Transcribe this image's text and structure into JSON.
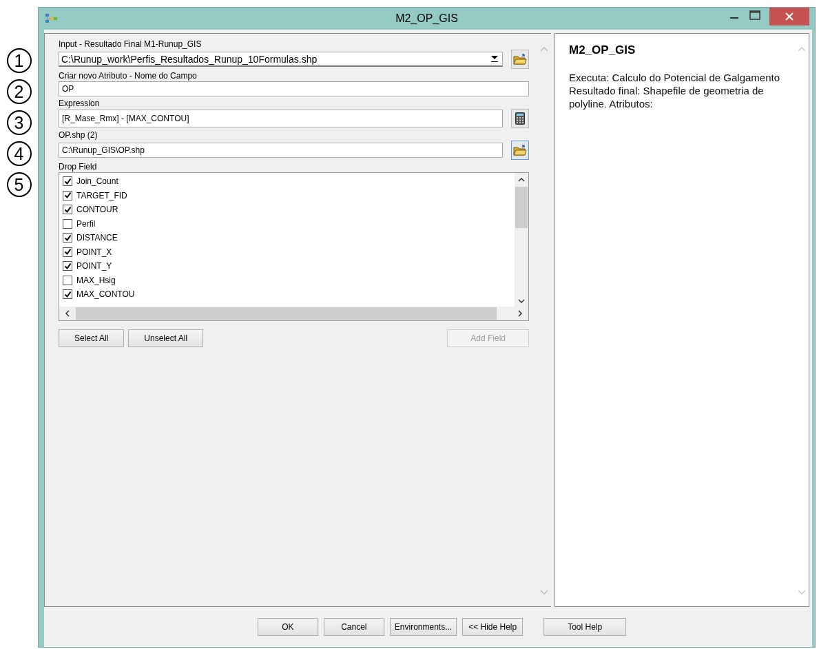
{
  "annotations": [
    "1",
    "2",
    "3",
    "4",
    "5"
  ],
  "window": {
    "title": "M2_OP_GIS"
  },
  "parameters": [
    {
      "kind": "combo",
      "label": "Input - Resultado Final M1-Runup_GIS",
      "value": "C:\\Runup_work\\Perfis_Resultados_Runup_10Formulas.shp",
      "button": {
        "kind": "browse"
      }
    },
    {
      "kind": "text",
      "label": "Criar novo Atributo - Nome do Campo",
      "value": "OP"
    },
    {
      "kind": "text",
      "label": "Expression",
      "value": "[R_Mase_Rmx] - [MAX_CONTOU]",
      "button": {
        "kind": "calculator"
      }
    },
    {
      "kind": "text",
      "label": "OP.shp (2)",
      "value": "C:\\Runup_GIS\\OP.shp",
      "button": {
        "kind": "browse"
      }
    }
  ],
  "drop_field": {
    "label": "Drop Field",
    "items": [
      {
        "label": "Join_Count",
        "checked": true
      },
      {
        "label": "TARGET_FID",
        "checked": true
      },
      {
        "label": "CONTOUR",
        "checked": true
      },
      {
        "label": "Perfil",
        "checked": false
      },
      {
        "label": "DISTANCE",
        "checked": true
      },
      {
        "label": "POINT_X",
        "checked": true
      },
      {
        "label": "POINT_Y",
        "checked": true
      },
      {
        "label": "MAX_Hsig",
        "checked": false
      },
      {
        "label": "MAX_CONTOU",
        "checked": true
      }
    ],
    "buttons": [
      {
        "label": "Select All",
        "disabled": false
      },
      {
        "label": "Unselect All",
        "disabled": false
      },
      {
        "label": "Add Field",
        "disabled": true
      }
    ]
  },
  "help": {
    "title": "M2_OP_GIS",
    "text": "Executa: Calculo do Potencial de Galgamento Resultado final: Shapefile de geometria de polyline. Atributos:"
  },
  "footer_buttons": [
    "OK",
    "Cancel",
    "Environments...",
    "<< Hide Help",
    "Tool Help"
  ]
}
